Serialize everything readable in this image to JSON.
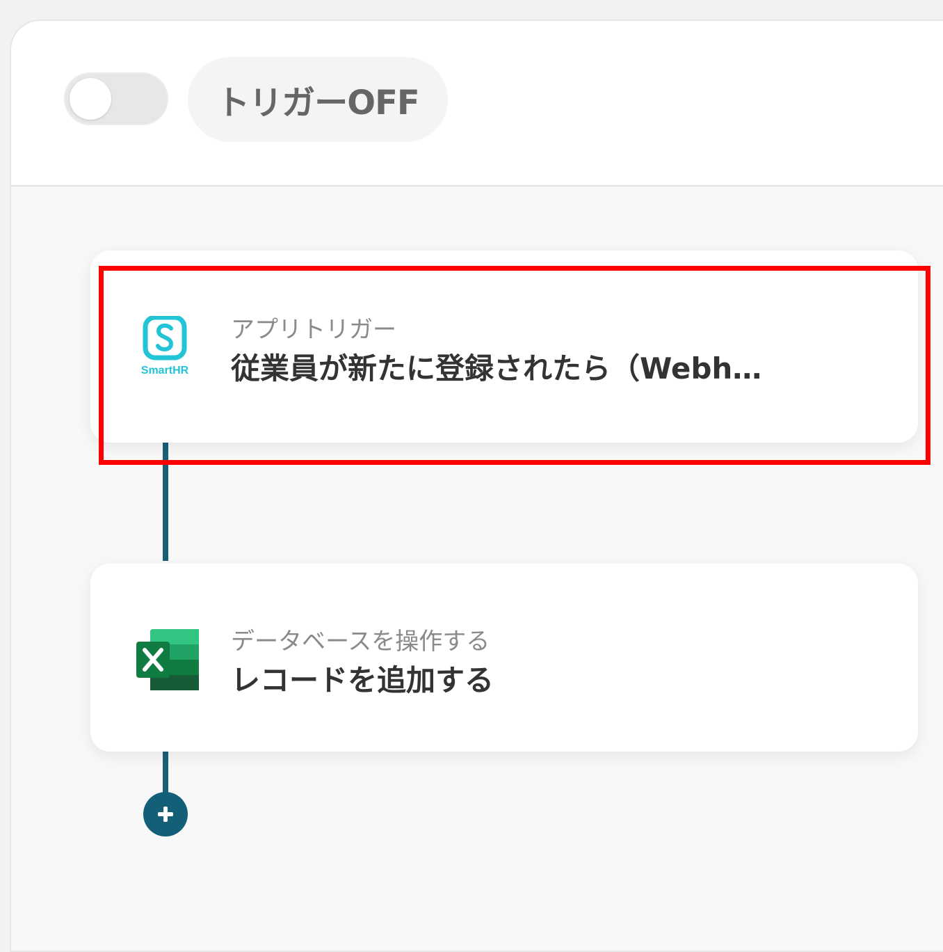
{
  "header": {
    "toggle_state": "off",
    "trigger_label": "トリガーOFF"
  },
  "flow": {
    "steps": [
      {
        "app": "SmartHR",
        "app_logo_text": "SmartHR",
        "icon": "smarthr-logo-icon",
        "subtitle": "アプリトリガー",
        "title": "従業員が新たに登録されたら（Webh…",
        "highlighted": true
      },
      {
        "app": "Microsoft Excel",
        "icon": "excel-logo-icon",
        "subtitle": "データベースを操作する",
        "title": "レコードを追加する",
        "highlighted": false
      }
    ],
    "add_step_icon": "plus-icon"
  },
  "colors": {
    "connector": "#1b5f79",
    "highlight": "#ff0000",
    "smarthr": "#22c4d6",
    "excel_green": "#107c41"
  }
}
